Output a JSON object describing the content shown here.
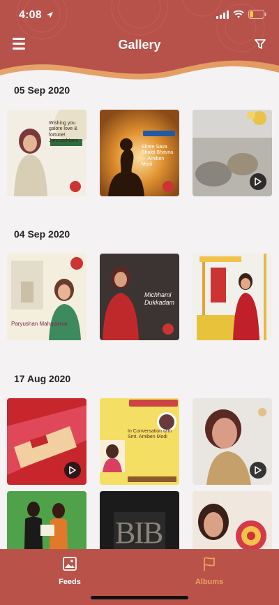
{
  "status": {
    "time": "4:08"
  },
  "nav": {
    "title": "Gallery"
  },
  "sections": [
    {
      "date": "05 Sep 2020",
      "items": [
        {
          "kind": "image",
          "caption": "Wishing you galore love & fortune! Janmashtami"
        },
        {
          "kind": "image",
          "caption": "Shree Sava Bhakti Bhavna — Amiben Modi"
        },
        {
          "kind": "video"
        }
      ]
    },
    {
      "date": "04 Sep 2020",
      "items": [
        {
          "kind": "image",
          "caption": "Paryushan Mahaparva"
        },
        {
          "kind": "image",
          "caption": "Michhami Dukkadam"
        },
        {
          "kind": "image"
        }
      ]
    },
    {
      "date": "17 Aug 2020",
      "items": [
        {
          "kind": "video"
        },
        {
          "kind": "image",
          "caption": "In Conversation with Smt. Amiben Modi"
        },
        {
          "kind": "video"
        }
      ]
    },
    {
      "date": "",
      "items": [
        {
          "kind": "image"
        },
        {
          "kind": "image",
          "caption": "BIB"
        },
        {
          "kind": "image"
        }
      ]
    }
  ],
  "tabs": {
    "feeds": "Feeds",
    "albums": "Albums"
  },
  "colors": {
    "brand": "#b9534a",
    "active_tab": "#ffffff",
    "inactive_tab": "#e8a35a"
  }
}
